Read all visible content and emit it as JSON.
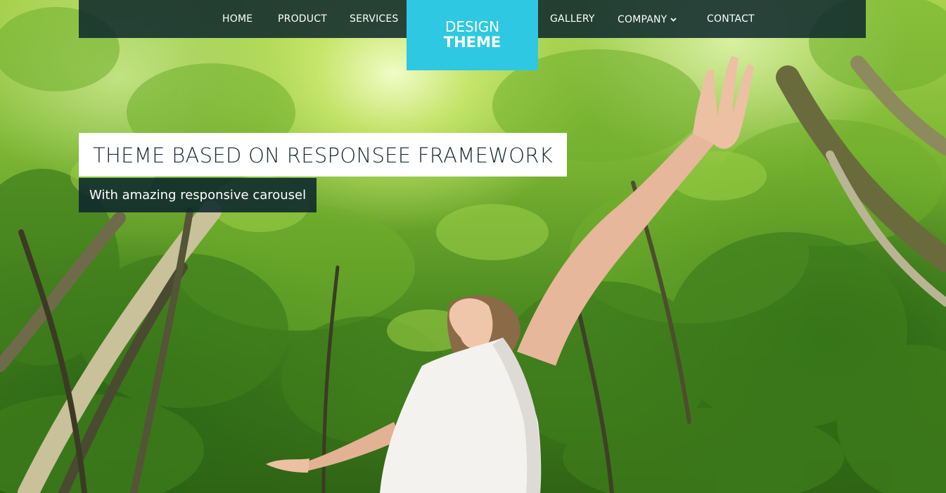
{
  "nav": {
    "items": [
      {
        "label": "HOME"
      },
      {
        "label": "PRODUCT"
      },
      {
        "label": "SERVICES"
      },
      {
        "label": "GALLERY"
      },
      {
        "label": "COMPANY"
      },
      {
        "label": "CONTACT"
      }
    ],
    "dropdown_icon": "chevron-down-icon"
  },
  "logo": {
    "line1": "DESIGN",
    "line2": "THEME"
  },
  "hero": {
    "title": "THEME BASED ON RESPONSEE FRAMEWORK",
    "subtitle": "With amazing responsive carousel",
    "image": "woman-with-raised-arms-in-forest"
  },
  "colors": {
    "nav_bg": "#0d262c",
    "logo_bg": "#2ec8e2",
    "caption_title_bg": "#ffffff",
    "caption_title_text": "#1a2b33",
    "caption_sub_bg": "#0d262c",
    "text_light": "#ffffff"
  }
}
